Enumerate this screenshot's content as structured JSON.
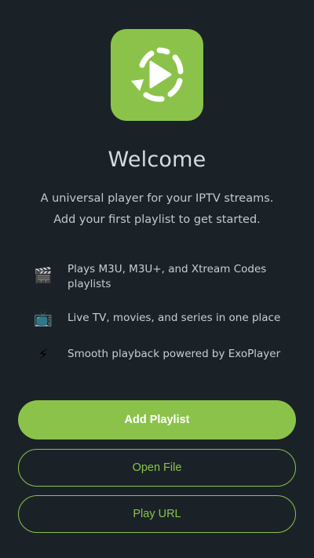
{
  "app": {
    "logo_icon": "play-refresh-icon",
    "accent_color": "#8bc34a",
    "background_color": "#1a2228"
  },
  "welcome": {
    "title": "Welcome",
    "subtitle": "A universal player for your IPTV streams. Add your first playlist to get started."
  },
  "features": [
    {
      "emoji": "🎬",
      "icon": "clapperboard-icon",
      "text": "Plays M3U, M3U+, and Xtream Codes playlists"
    },
    {
      "emoji": "📺",
      "icon": "television-icon",
      "text": "Live TV, movies, and series in one place"
    },
    {
      "emoji": "⚡",
      "icon": "lightning-icon",
      "text": "Smooth playback powered by ExoPlayer"
    }
  ],
  "actions": {
    "add_playlist": "Add Playlist",
    "open_file": "Open File",
    "play_url": "Play URL"
  }
}
